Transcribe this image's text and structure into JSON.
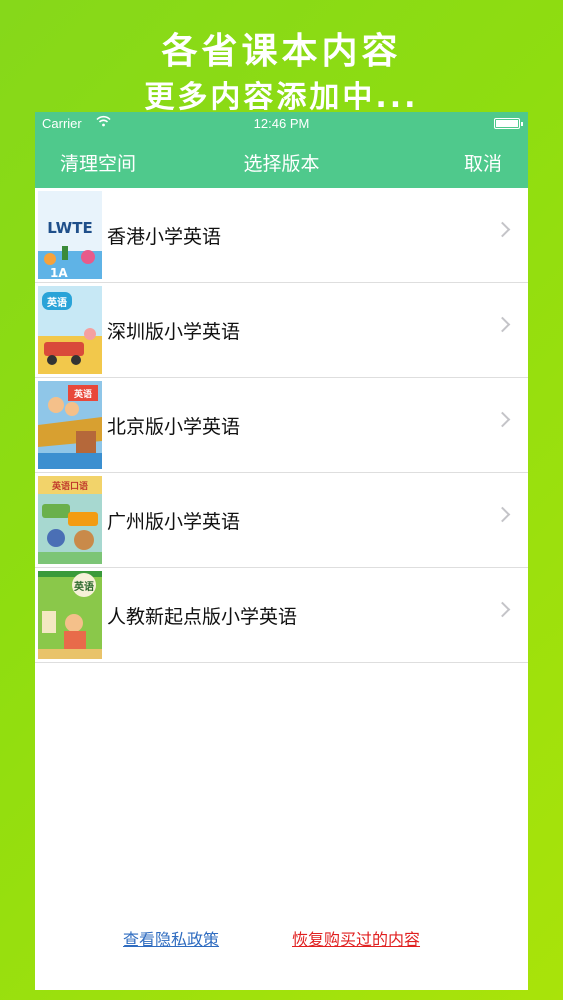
{
  "promo": {
    "line1": "各省课本内容",
    "line2": "更多内容添加中..."
  },
  "status_bar": {
    "carrier": "Carrier",
    "time": "12:46 PM"
  },
  "nav": {
    "left_label": "清理空间",
    "title": "选择版本",
    "right_label": "取消"
  },
  "books": [
    {
      "label": "香港小学英语",
      "cover_text": "LWTE",
      "cover_sub": "1A"
    },
    {
      "label": "深圳版小学英语",
      "cover_text": "英语"
    },
    {
      "label": "北京版小学英语",
      "cover_text": "英语"
    },
    {
      "label": "广州版小学英语",
      "cover_text": "英语口语"
    },
    {
      "label": "人教新起点版小学英语",
      "cover_text": "英语"
    }
  ],
  "footer": {
    "privacy_label": "查看隐私政策",
    "restore_label": "恢复购买过的内容"
  },
  "colors": {
    "accent": "#4fc98c",
    "background": "#8fdd10",
    "privacy_link": "#2f6cc0",
    "restore_link": "#e02020"
  }
}
